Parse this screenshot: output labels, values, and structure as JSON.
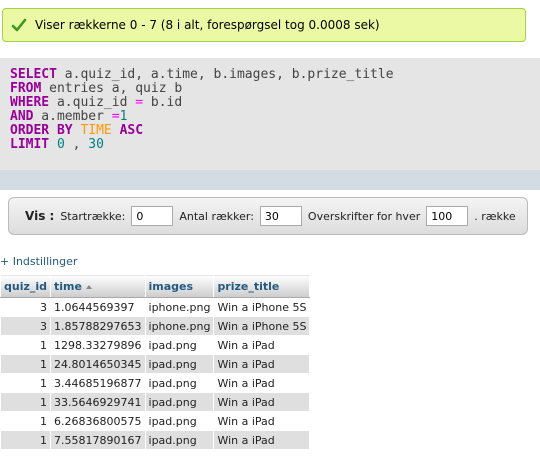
{
  "status": {
    "message": "Viser rækkerne 0 - 7 (8 i alt, forespørgsel tog 0.0008 sek)",
    "color": "#ebf8a4"
  },
  "sql": {
    "select": "SELECT",
    "select_cols": " a.quiz_id, a.time, b.images, b.prize_title",
    "from": "FROM",
    "from_tables": " entries a, quiz b",
    "where": "WHERE",
    "where_left": " a.quiz_id ",
    "where_op": "=",
    "where_right": " b.id",
    "and": "AND",
    "and_left": " a.member ",
    "and_op": "=",
    "and_val": "1",
    "order_by": "ORDER BY",
    "order_fn": "TIME",
    "asc": "ASC",
    "limit": "LIMIT",
    "limit_a": "0",
    "limit_sep": " , ",
    "limit_b": "30"
  },
  "navigation": {
    "show_label": "Vis :",
    "start_row_label": "Startrække:",
    "start_row_value": "0",
    "row_count_label": "Antal rækker:",
    "row_count_value": "30",
    "headers_every_label": "Overskrifter for hver",
    "headers_every_value": "100",
    "row_suffix": ". række"
  },
  "settings_link": "+ Indstillinger",
  "table": {
    "columns": [
      "quiz_id",
      "time",
      "images",
      "prize_title"
    ],
    "rows": [
      [
        "3",
        "1.0644569397",
        "iphone.png",
        "Win a iPhone 5S"
      ],
      [
        "3",
        "1.85788297653",
        "iphone.png",
        "Win a iPhone 5S"
      ],
      [
        "1",
        "1298.33279896",
        "ipad.png",
        "Win a iPad"
      ],
      [
        "1",
        "24.8014650345",
        "ipad.png",
        "Win a iPad"
      ],
      [
        "1",
        "3.44685196877",
        "ipad.png",
        "Win a iPad"
      ],
      [
        "1",
        "33.5646929741",
        "ipad.png",
        "Win a iPad"
      ],
      [
        "1",
        "6.26836800575",
        "ipad.png",
        "Win a iPad"
      ],
      [
        "1",
        "7.55817890167",
        "ipad.png",
        "Win a iPad"
      ]
    ]
  }
}
